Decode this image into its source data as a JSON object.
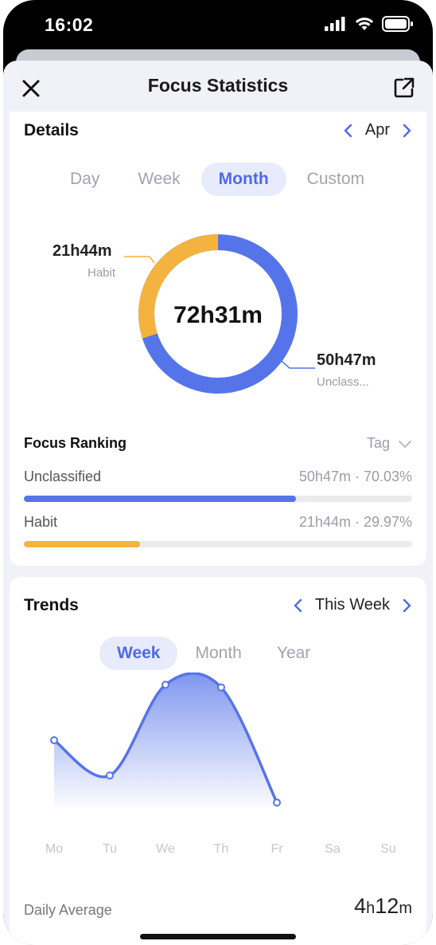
{
  "status_bar": {
    "time": "16:02"
  },
  "nav": {
    "title": "Focus Statistics"
  },
  "details": {
    "title": "Details",
    "period_label": "Apr",
    "segments": [
      "Day",
      "Week",
      "Month",
      "Custom"
    ],
    "active_segment": "Month",
    "total": "72h31m",
    "habit_value": "21h44m",
    "habit_label": "Habit",
    "unclassified_value": "50h47m",
    "unclassified_label": "Unclass...",
    "colors": {
      "unclassified": "#5674ea",
      "habit": "#f4b33f"
    }
  },
  "ranking": {
    "title": "Focus Ranking",
    "filter_label": "Tag",
    "items": [
      {
        "name": "Unclassified",
        "stat": "50h47m · 70.03%",
        "fraction": 0.7003,
        "color": "#5674ea"
      },
      {
        "name": "Habit",
        "stat": "21h44m · 29.97%",
        "fraction": 0.2997,
        "color": "#f4b33f"
      }
    ]
  },
  "trends": {
    "title": "Trends",
    "period_label": "This Week",
    "segments": [
      "Week",
      "Month",
      "Year"
    ],
    "active_segment": "Week",
    "days": [
      "Mo",
      "Tu",
      "We",
      "Th",
      "Fr",
      "Sa",
      "Su"
    ],
    "daily_average_label": "Daily Average",
    "daily_average_hours": "4",
    "daily_average_h_unit": "h",
    "daily_average_minutes": "12",
    "daily_average_m_unit": "m"
  },
  "chart_data": {
    "type": "area",
    "x": [
      "Mo",
      "Tu",
      "We",
      "Th",
      "Fr",
      "Sa",
      "Su"
    ],
    "values": [
      5.0,
      2.4,
      9.1,
      8.9,
      0.4,
      null,
      null
    ],
    "color": "#5674ea"
  }
}
